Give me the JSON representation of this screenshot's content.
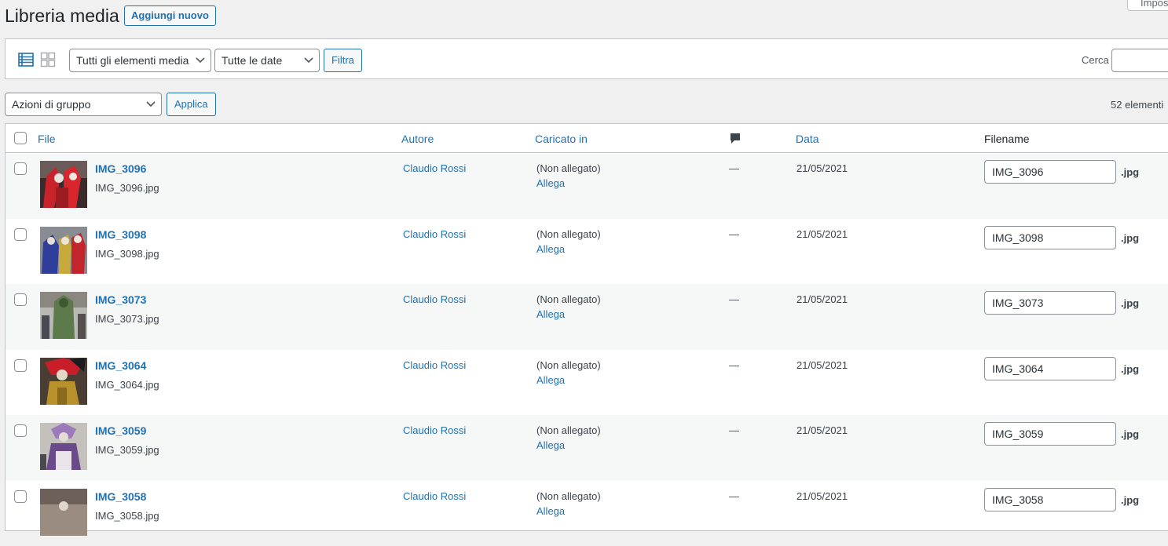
{
  "header": {
    "title": "Libreria media",
    "add_new": "Aggiungi nuovo",
    "screen_options": "Impos"
  },
  "filters": {
    "type_select": "Tutti gli elementi media",
    "date_select": "Tutte le date",
    "filter_button": "Filtra",
    "search_label": "Cerca",
    "search_value": ""
  },
  "bulk": {
    "action_select": "Azioni di gruppo",
    "apply_button": "Applica",
    "count": "52 elementi"
  },
  "columns": {
    "file": "File",
    "author": "Autore",
    "uploaded_to": "Caricato in",
    "date": "Data",
    "filename": "Filename"
  },
  "rows": [
    {
      "title": "IMG_3096",
      "file": "IMG_3096.jpg",
      "author": "Claudio Rossi",
      "attached": "(Non allegato)",
      "attach": "Allega",
      "comments": "—",
      "date": "21/05/2021",
      "filename": "IMG_3096",
      "ext": ".jpg"
    },
    {
      "title": "IMG_3098",
      "file": "IMG_3098.jpg",
      "author": "Claudio Rossi",
      "attached": "(Non allegato)",
      "attach": "Allega",
      "comments": "—",
      "date": "21/05/2021",
      "filename": "IMG_3098",
      "ext": ".jpg"
    },
    {
      "title": "IMG_3073",
      "file": "IMG_3073.jpg",
      "author": "Claudio Rossi",
      "attached": "(Non allegato)",
      "attach": "Allega",
      "comments": "—",
      "date": "21/05/2021",
      "filename": "IMG_3073",
      "ext": ".jpg"
    },
    {
      "title": "IMG_3064",
      "file": "IMG_3064.jpg",
      "author": "Claudio Rossi",
      "attached": "(Non allegato)",
      "attach": "Allega",
      "comments": "—",
      "date": "21/05/2021",
      "filename": "IMG_3064",
      "ext": ".jpg"
    },
    {
      "title": "IMG_3059",
      "file": "IMG_3059.jpg",
      "author": "Claudio Rossi",
      "attached": "(Non allegato)",
      "attach": "Allega",
      "comments": "—",
      "date": "21/05/2021",
      "filename": "IMG_3059",
      "ext": ".jpg"
    },
    {
      "title": "IMG_3058",
      "file": "IMG_3058.jpg",
      "author": "Claudio Rossi",
      "attached": "(Non allegato)",
      "attach": "Allega",
      "comments": "—",
      "date": "21/05/2021",
      "filename": "IMG_3058",
      "ext": ".jpg"
    }
  ],
  "icons": {
    "list_view": "list-view-icon",
    "grid_view": "grid-view-icon",
    "comments": "comment-bubble-icon",
    "dropdown": "chevron-down-icon"
  },
  "colors": {
    "link": "#2271b1",
    "background": "#f0f0f1",
    "row_alt": "#f6f7f7"
  }
}
